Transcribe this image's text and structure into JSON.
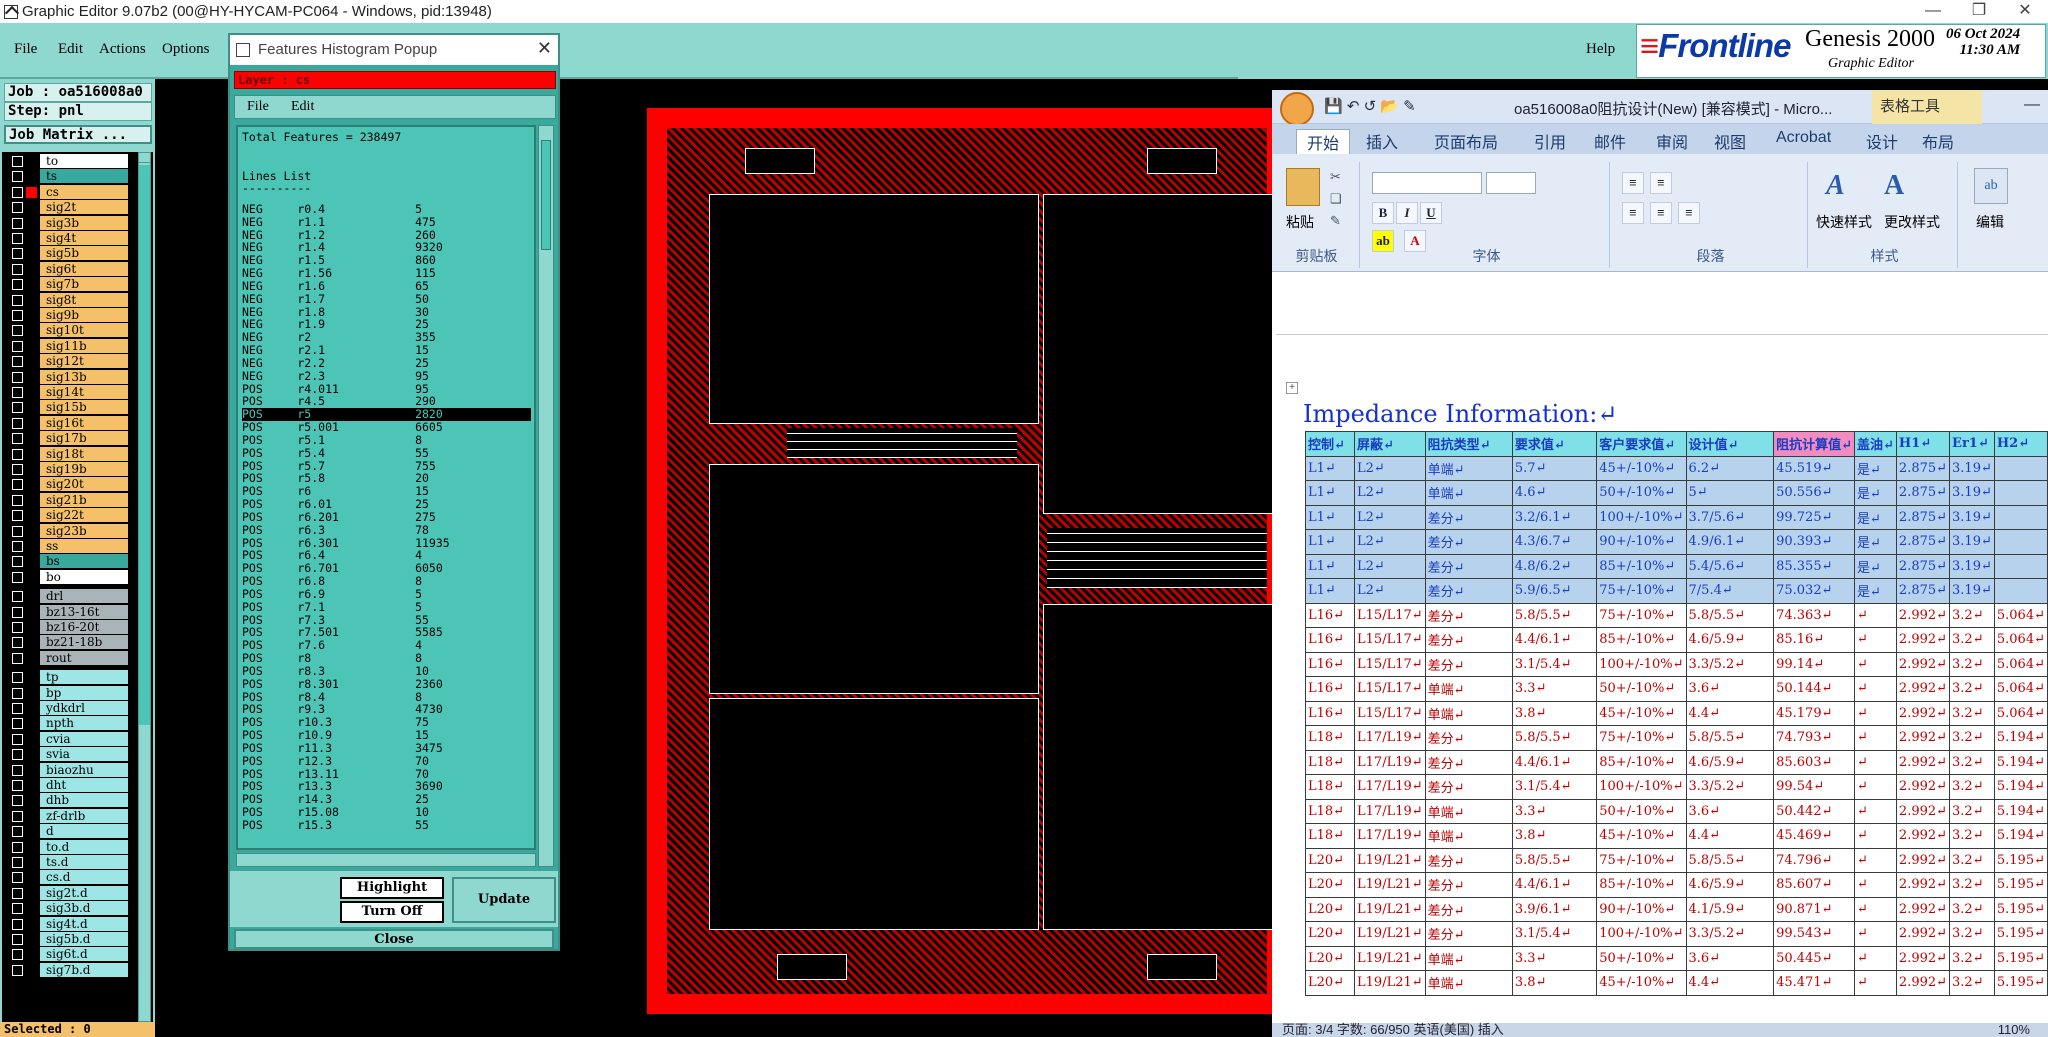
{
  "titlebar": {
    "title": "Graphic Editor 9.07b2 (00@HY-HYCAM-PC064 - Windows, pid:13948)"
  },
  "menu": {
    "file": "File",
    "edit": "Edit",
    "actions": "Actions",
    "options": "Options",
    "help": "Help"
  },
  "brand": {
    "logo": "Frontline",
    "product": "Genesis 2000",
    "sub": "Graphic Editor",
    "date": "06 Oct 2024",
    "time": "11:30 AM"
  },
  "job": {
    "job": "Job : oa516008a0",
    "step": "Step: pnl",
    "matrix_btn": "Job Matrix ...",
    "selected": "Selected : 0"
  },
  "colors": {
    "signal": "#f4c069",
    "active": "#3aa99d",
    "drill": "#a8b4b8",
    "other": "#9ee6e6",
    "red": "#ff0000"
  },
  "layers": [
    {
      "name": "to",
      "t": "w"
    },
    {
      "name": "ts",
      "t": "g"
    },
    {
      "name": "cs",
      "t": "s",
      "active": true
    },
    {
      "name": "sig2t",
      "t": "s"
    },
    {
      "name": "sig3b",
      "t": "s"
    },
    {
      "name": "sig4t",
      "t": "s"
    },
    {
      "name": "sig5b",
      "t": "s"
    },
    {
      "name": "sig6t",
      "t": "s"
    },
    {
      "name": "sig7b",
      "t": "s"
    },
    {
      "name": "sig8t",
      "t": "s"
    },
    {
      "name": "sig9b",
      "t": "s"
    },
    {
      "name": "sig10t",
      "t": "s"
    },
    {
      "name": "sig11b",
      "t": "s"
    },
    {
      "name": "sig12t",
      "t": "s"
    },
    {
      "name": "sig13b",
      "t": "s"
    },
    {
      "name": "sig14t",
      "t": "s"
    },
    {
      "name": "sig15b",
      "t": "s"
    },
    {
      "name": "sig16t",
      "t": "s"
    },
    {
      "name": "sig17b",
      "t": "s"
    },
    {
      "name": "sig18t",
      "t": "s"
    },
    {
      "name": "sig19b",
      "t": "s"
    },
    {
      "name": "sig20t",
      "t": "s"
    },
    {
      "name": "sig21b",
      "t": "s"
    },
    {
      "name": "sig22t",
      "t": "s"
    },
    {
      "name": "sig23b",
      "t": "s"
    },
    {
      "name": "ss",
      "t": "s"
    },
    {
      "name": "bs",
      "t": "g"
    },
    {
      "name": "bo",
      "t": "w"
    },
    {
      "name": "drl",
      "t": "d",
      "gap": true
    },
    {
      "name": "bz13-16t",
      "t": "d"
    },
    {
      "name": "bz16-20t",
      "t": "d"
    },
    {
      "name": "bz21-18b",
      "t": "d"
    },
    {
      "name": "rout",
      "t": "d"
    },
    {
      "name": "tp",
      "t": "o",
      "gap": true
    },
    {
      "name": "bp",
      "t": "o"
    },
    {
      "name": "ydkdrl",
      "t": "o"
    },
    {
      "name": "npth",
      "t": "o"
    },
    {
      "name": "cvia",
      "t": "o"
    },
    {
      "name": "svia",
      "t": "o"
    },
    {
      "name": "biaozhu",
      "t": "o"
    },
    {
      "name": "dht",
      "t": "o"
    },
    {
      "name": "dhb",
      "t": "o"
    },
    {
      "name": "zf-drlb",
      "t": "o"
    },
    {
      "name": "d",
      "t": "o"
    },
    {
      "name": "to.d",
      "t": "o"
    },
    {
      "name": "ts.d",
      "t": "o"
    },
    {
      "name": "cs.d",
      "t": "o"
    },
    {
      "name": "sig2t.d",
      "t": "o"
    },
    {
      "name": "sig3b.d",
      "t": "o"
    },
    {
      "name": "sig4t.d",
      "t": "o"
    },
    {
      "name": "sig5b.d",
      "t": "o"
    },
    {
      "name": "sig6t.d",
      "t": "o"
    },
    {
      "name": "sig7b.d",
      "t": "o"
    }
  ],
  "popup": {
    "title": "Features Histogram Popup",
    "layer": "Layer :  cs",
    "file": "File",
    "edit": "Edit",
    "total": "Total Features = 238497",
    "list_title": "Lines List",
    "underline": "----------",
    "highlight": "Highlight",
    "turnoff": "Turn Off",
    "update": "Update",
    "close": "Close",
    "rows": [
      [
        "NEG",
        "r0.4",
        "5"
      ],
      [
        "NEG",
        "r1.1",
        "475"
      ],
      [
        "NEG",
        "r1.2",
        "260"
      ],
      [
        "NEG",
        "r1.4",
        "9320"
      ],
      [
        "NEG",
        "r1.5",
        "860"
      ],
      [
        "NEG",
        "r1.56",
        "115"
      ],
      [
        "NEG",
        "r1.6",
        "65"
      ],
      [
        "NEG",
        "r1.7",
        "50"
      ],
      [
        "NEG",
        "r1.8",
        "30"
      ],
      [
        "NEG",
        "r1.9",
        "25"
      ],
      [
        "NEG",
        "r2",
        "355"
      ],
      [
        "NEG",
        "r2.1",
        "15"
      ],
      [
        "NEG",
        "r2.2",
        "25"
      ],
      [
        "NEG",
        "r2.3",
        "95"
      ],
      [
        "POS",
        "r4.011",
        "95"
      ],
      [
        "POS",
        "r4.5",
        "290"
      ],
      [
        "POS",
        "r5",
        "2820"
      ],
      [
        "POS",
        "r5.001",
        "6605"
      ],
      [
        "POS",
        "r5.1",
        "8"
      ],
      [
        "POS",
        "r5.4",
        "55"
      ],
      [
        "POS",
        "r5.7",
        "755"
      ],
      [
        "POS",
        "r5.8",
        "20"
      ],
      [
        "POS",
        "r6",
        "15"
      ],
      [
        "POS",
        "r6.01",
        "25"
      ],
      [
        "POS",
        "r6.201",
        "275"
      ],
      [
        "POS",
        "r6.3",
        "78"
      ],
      [
        "POS",
        "r6.301",
        "11935"
      ],
      [
        "POS",
        "r6.4",
        "4"
      ],
      [
        "POS",
        "r6.701",
        "6050"
      ],
      [
        "POS",
        "r6.8",
        "8"
      ],
      [
        "POS",
        "r6.9",
        "5"
      ],
      [
        "POS",
        "r7.1",
        "5"
      ],
      [
        "POS",
        "r7.3",
        "55"
      ],
      [
        "POS",
        "r7.501",
        "5585"
      ],
      [
        "POS",
        "r7.6",
        "4"
      ],
      [
        "POS",
        "r8",
        "8"
      ],
      [
        "POS",
        "r8.3",
        "10"
      ],
      [
        "POS",
        "r8.301",
        "2360"
      ],
      [
        "POS",
        "r8.4",
        "8"
      ],
      [
        "POS",
        "r9.3",
        "4730"
      ],
      [
        "POS",
        "r10.3",
        "75"
      ],
      [
        "POS",
        "r10.9",
        "15"
      ],
      [
        "POS",
        "r11.3",
        "3475"
      ],
      [
        "POS",
        "r12.3",
        "70"
      ],
      [
        "POS",
        "r13.11",
        "70"
      ],
      [
        "POS",
        "r13.3",
        "3690"
      ],
      [
        "POS",
        "r14.3",
        "25"
      ],
      [
        "POS",
        "r15.08",
        "10"
      ],
      [
        "POS",
        "r15.3",
        "55"
      ]
    ],
    "highlighted_row": 16
  },
  "word": {
    "doc_title": "oa516008a0阻抗设计(New) [兼容模式] - Micro...",
    "tools": "表格工具",
    "tabs": [
      "开始",
      "插入",
      "页面布局",
      "引用",
      "邮件",
      "审阅",
      "视图",
      "Acrobat",
      "设计",
      "布局"
    ],
    "groups": {
      "clipboard": "剪贴板",
      "font": "字体",
      "para": "段落",
      "style": "样式",
      "paste": "粘贴",
      "quick": "快速样式",
      "change": "更改样式",
      "edit": "编辑"
    },
    "heading": "Impedance Information:↵",
    "columns": [
      "控制↵",
      "屏蔽↵",
      "阻抗类型↵",
      "要求值↵",
      "客户要求值↵",
      "设计值↵",
      "阻抗计算值↵",
      "盖油↵",
      "H1↵",
      "Er1↵",
      "H2↵"
    ],
    "rows": [
      [
        "L1↵",
        "L2↵",
        "单端↵",
        "5.7↵",
        "45+/-10%↵",
        "6.2↵",
        "45.519↵",
        "是↵",
        "2.875↵",
        "3.19↵",
        ""
      ],
      [
        "L1↵",
        "L2↵",
        "单端↵",
        "4.6↵",
        "50+/-10%↵",
        "5↵",
        "50.556↵",
        "是↵",
        "2.875↵",
        "3.19↵",
        ""
      ],
      [
        "L1↵",
        "L2↵",
        "差分↵",
        "3.2/6.1↵",
        "100+/-10%↵",
        "3.7/5.6↵",
        "99.725↵",
        "是↵",
        "2.875↵",
        "3.19↵",
        ""
      ],
      [
        "L1↵",
        "L2↵",
        "差分↵",
        "4.3/6.7↵",
        "90+/-10%↵",
        "4.9/6.1↵",
        "90.393↵",
        "是↵",
        "2.875↵",
        "3.19↵",
        ""
      ],
      [
        "L1↵",
        "L2↵",
        "差分↵",
        "4.8/6.2↵",
        "85+/-10%↵",
        "5.4/5.6↵",
        "85.355↵",
        "是↵",
        "2.875↵",
        "3.19↵",
        ""
      ],
      [
        "L1↵",
        "L2↵",
        "差分↵",
        "5.9/6.5↵",
        "75+/-10%↵",
        "7/5.4↵",
        "75.032↵",
        "是↵",
        "2.875↵",
        "3.19↵",
        ""
      ],
      [
        "L16↵",
        "L15/L17↵",
        "差分↵",
        "5.8/5.5↵",
        "75+/-10%↵",
        "5.8/5.5↵",
        "74.363↵",
        "↵",
        "2.992↵",
        "3.2↵",
        "5.064↵"
      ],
      [
        "L16↵",
        "L15/L17↵",
        "差分↵",
        "4.4/6.1↵",
        "85+/-10%↵",
        "4.6/5.9↵",
        "85.16↵",
        "↵",
        "2.992↵",
        "3.2↵",
        "5.064↵"
      ],
      [
        "L16↵",
        "L15/L17↵",
        "差分↵",
        "3.1/5.4↵",
        "100+/-10%↵",
        "3.3/5.2↵",
        "99.14↵",
        "↵",
        "2.992↵",
        "3.2↵",
        "5.064↵"
      ],
      [
        "L16↵",
        "L15/L17↵",
        "单端↵",
        "3.3↵",
        "50+/-10%↵",
        "3.6↵",
        "50.144↵",
        "↵",
        "2.992↵",
        "3.2↵",
        "5.064↵"
      ],
      [
        "L16↵",
        "L15/L17↵",
        "单端↵",
        "3.8↵",
        "45+/-10%↵",
        "4.4↵",
        "45.179↵",
        "↵",
        "2.992↵",
        "3.2↵",
        "5.064↵"
      ],
      [
        "L18↵",
        "L17/L19↵",
        "差分↵",
        "5.8/5.5↵",
        "75+/-10%↵",
        "5.8/5.5↵",
        "74.793↵",
        "↵",
        "2.992↵",
        "3.2↵",
        "5.194↵"
      ],
      [
        "L18↵",
        "L17/L19↵",
        "差分↵",
        "4.4/6.1↵",
        "85+/-10%↵",
        "4.6/5.9↵",
        "85.603↵",
        "↵",
        "2.992↵",
        "3.2↵",
        "5.194↵"
      ],
      [
        "L18↵",
        "L17/L19↵",
        "差分↵",
        "3.1/5.4↵",
        "100+/-10%↵",
        "3.3/5.2↵",
        "99.54↵",
        "↵",
        "2.992↵",
        "3.2↵",
        "5.194↵"
      ],
      [
        "L18↵",
        "L17/L19↵",
        "单端↵",
        "3.3↵",
        "50+/-10%↵",
        "3.6↵",
        "50.442↵",
        "↵",
        "2.992↵",
        "3.2↵",
        "5.194↵"
      ],
      [
        "L18↵",
        "L17/L19↵",
        "单端↵",
        "3.8↵",
        "45+/-10%↵",
        "4.4↵",
        "45.469↵",
        "↵",
        "2.992↵",
        "3.2↵",
        "5.194↵"
      ],
      [
        "L20↵",
        "L19/L21↵",
        "差分↵",
        "5.8/5.5↵",
        "75+/-10%↵",
        "5.8/5.5↵",
        "74.796↵",
        "↵",
        "2.992↵",
        "3.2↵",
        "5.195↵"
      ],
      [
        "L20↵",
        "L19/L21↵",
        "差分↵",
        "4.4/6.1↵",
        "85+/-10%↵",
        "4.6/5.9↵",
        "85.607↵",
        "↵",
        "2.992↵",
        "3.2↵",
        "5.195↵"
      ],
      [
        "L20↵",
        "L19/L21↵",
        "差分↵",
        "3.9/6.1↵",
        "90+/-10%↵",
        "4.1/5.9↵",
        "90.871↵",
        "↵",
        "2.992↵",
        "3.2↵",
        "5.195↵"
      ],
      [
        "L20↵",
        "L19/L21↵",
        "差分↵",
        "3.1/5.4↵",
        "100+/-10%↵",
        "3.3/5.2↵",
        "99.543↵",
        "↵",
        "2.992↵",
        "3.2↵",
        "5.195↵"
      ],
      [
        "L20↵",
        "L19/L21↵",
        "单端↵",
        "3.3↵",
        "50+/-10%↵",
        "3.6↵",
        "50.445↵",
        "↵",
        "2.992↵",
        "3.2↵",
        "5.195↵"
      ],
      [
        "L20↵",
        "L19/L21↵",
        "单端↵",
        "3.8↵",
        "45+/-10%↵",
        "4.4↵",
        "45.471↵",
        "↵",
        "2.992↵",
        "3.2↵",
        "5.195↵"
      ]
    ],
    "status": "页面: 3/4   字数: 66/950   英语(美国)   插入",
    "zoom": "110%"
  }
}
